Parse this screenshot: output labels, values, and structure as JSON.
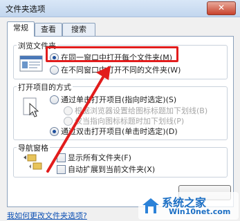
{
  "window": {
    "title": "文件夹选项",
    "close_glyph": "✕"
  },
  "tabs": [
    {
      "label": "常规",
      "active": true
    },
    {
      "label": "查看",
      "active": false
    },
    {
      "label": "搜索",
      "active": false
    }
  ],
  "browse": {
    "legend": "浏览文件夹",
    "options": [
      {
        "label": "在同一窗口中打开每个文件夹(M)",
        "checked": true
      },
      {
        "label": "在不同窗口中打开不同的文件夹(W)",
        "checked": false
      }
    ]
  },
  "open_items": {
    "legend": "打开项目的方式",
    "single_click": "通过单击打开项目(指向时选定)(S)",
    "underline_consistent": "根据浏览器设置给图标标题加下划线(B)",
    "underline_hover": "仅当指向图标标题时加下划线(P)",
    "double_click": "通过双击打开项目(单击时选定)(D)"
  },
  "nav_pane": {
    "legend": "导航窗格",
    "show_all": "显示所有文件夹(F)",
    "auto_expand": "自动扩展到当前文件夹(X)"
  },
  "footer": {
    "help_link": "我如何更改文件夹选项?"
  },
  "watermark": {
    "text": "系统之家",
    "url_text": "Win10net.com"
  },
  "colors": {
    "highlight": "#e21c1c",
    "accent": "#1e4f9c",
    "link": "#0b4fb3"
  }
}
